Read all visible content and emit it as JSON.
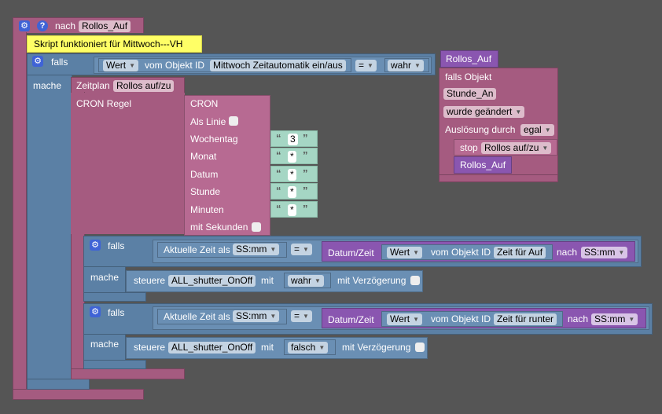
{
  "header": {
    "nach_label": "nach",
    "event_name": "Rollos_Auf"
  },
  "comment": "Skript funktioniert für Mittwoch---VH",
  "if1": {
    "falls": "falls",
    "mache": "mache",
    "wert": "Wert",
    "vom_objekt": "vom Objekt ID",
    "object": "Mittwoch Zeitautomatik ein/aus",
    "op": "=",
    "value": "wahr"
  },
  "schedule": {
    "label": "Zeitplan",
    "name": "Rollos auf/zu",
    "cron_regel": "CRON Regel"
  },
  "cron": {
    "title": "CRON",
    "als_linie": "Als Linie",
    "rows": [
      {
        "label": "Wochentag",
        "value": "3"
      },
      {
        "label": "Monat",
        "value": "*"
      },
      {
        "label": "Datum",
        "value": "*"
      },
      {
        "label": "Stunde",
        "value": "*"
      },
      {
        "label": "Minuten",
        "value": "*"
      }
    ],
    "mit_sekunden": "mit Sekunden"
  },
  "side": {
    "title": "Rollos_Auf",
    "falls_objekt": "falls Objekt",
    "object": "Stunde_An",
    "changed": "wurde geändert",
    "ausloesung": "Auslösung durch",
    "egal": "egal",
    "stop": "stop",
    "stop_name": "Rollos auf/zu",
    "bottom": "Rollos_Auf"
  },
  "if2": {
    "falls": "falls",
    "mache": "mache",
    "aktuelle": "Aktuelle Zeit als",
    "fmt": "SS:mm",
    "op": "=",
    "datum_zeit": "Datum/Zeit",
    "wert": "Wert",
    "vom_objekt": "vom Objekt ID",
    "object": "Zeit für Auf",
    "nach": "nach",
    "fmt2": "SS:mm",
    "steuere": "steuere",
    "target": "ALL_shutter_OnOff",
    "mit": "mit",
    "value": "wahr",
    "verzoegerung": "mit Verzögerung"
  },
  "if3": {
    "falls": "falls",
    "mache": "mache",
    "aktuelle": "Aktuelle Zeit als",
    "fmt": "SS:mm",
    "op": "=",
    "datum_zeit": "Datum/Zeit",
    "wert": "Wert",
    "vom_objekt": "vom Objekt ID",
    "object": "Zeit für runter",
    "nach": "nach",
    "fmt2": "SS:mm",
    "steuere": "steuere",
    "target": "ALL_shutter_OnOff",
    "mit": "mit",
    "value": "falsch",
    "verzoegerung": "mit Verzögerung"
  }
}
